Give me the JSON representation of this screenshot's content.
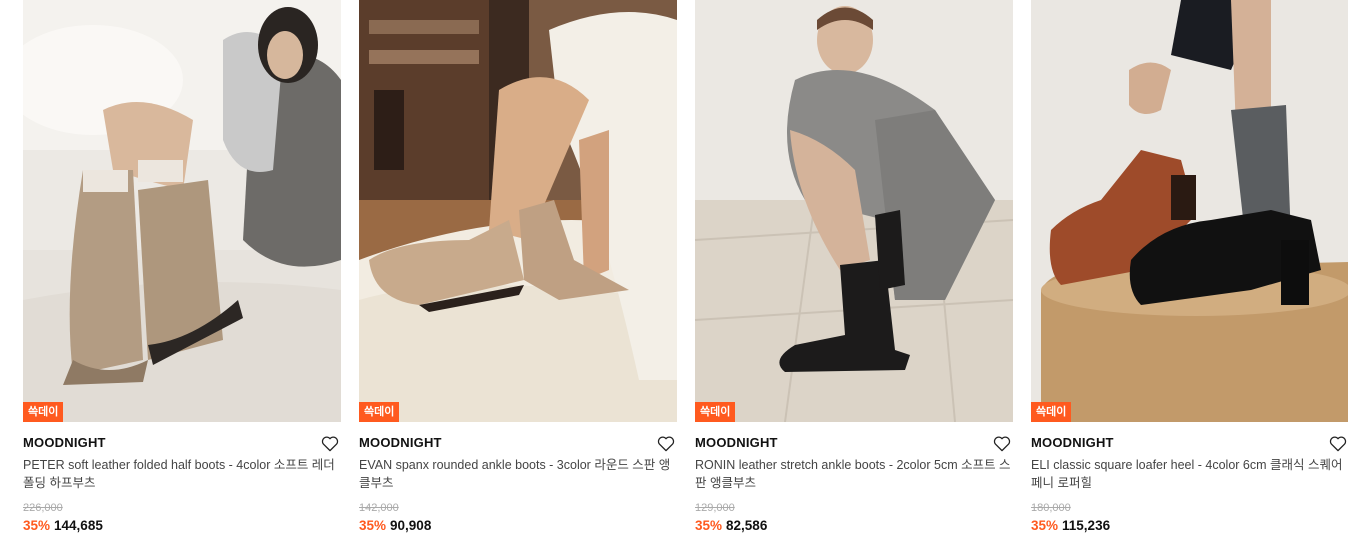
{
  "products": [
    {
      "badge": "쓱데이",
      "brand": "MOODNIGHT",
      "title": "PETER soft leather folded half boots - 4color 소프트 레더 폴딩 하프부츠",
      "original_price": "226,000",
      "discount": "35%",
      "price": "144,685",
      "wishlist_icon": "heart-outline-icon"
    },
    {
      "badge": "쓱데이",
      "brand": "MOODNIGHT",
      "title": "EVAN spanx rounded ankle boots - 3color 라운드 스판 앵클부츠",
      "original_price": "142,000",
      "discount": "35%",
      "price": "90,908",
      "wishlist_icon": "heart-outline-icon"
    },
    {
      "badge": "쓱데이",
      "brand": "MOODNIGHT",
      "title": "RONIN leather stretch ankle boots - 2color 5cm 소프트 스판 앵클부츠",
      "original_price": "129,000",
      "discount": "35%",
      "price": "82,586",
      "wishlist_icon": "heart-outline-icon"
    },
    {
      "badge": "쓱데이",
      "brand": "MOODNIGHT",
      "title": "ELI classic square loafer heel - 4color 6cm 클래식 스퀘어 페니 로퍼힐",
      "original_price": "180,000",
      "discount": "35%",
      "price": "115,236",
      "wishlist_icon": "heart-outline-icon"
    }
  ],
  "colors": {
    "accent": "#ff5a1f",
    "strike_price": "#aaaaaa",
    "title_text": "#444444"
  }
}
